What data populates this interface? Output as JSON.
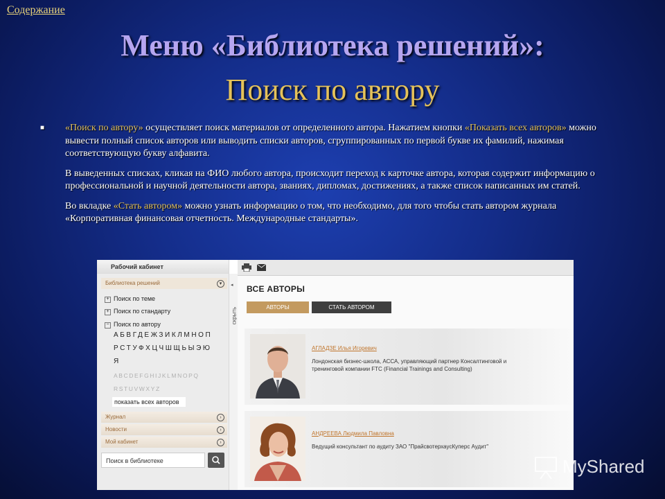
{
  "nav": {
    "toc_link": "Содержание"
  },
  "slide": {
    "title_line1": "Меню «Библиотека решений»:",
    "title_line2": "Поиск по автору",
    "p1_hl1": "«Поиск по автору»",
    "p1_text1": " осуществляет поиск материалов от определенного автора. Нажатием кнопки ",
    "p1_hl2": "«Показать всех авторов»",
    "p1_text2": " можно вывести полный список авторов или выводить списки авторов, сгруппированных по первой букве их фамилий, нажимая соответствующую букву алфавита.",
    "p2": "В выведенных списках, кликая на ФИО любого автора, происходит переход к карточке автора, которая содержит информацию о профессиональной и научной деятельности автора, званиях, дипломах, достижениях, а также список написанных им статей.",
    "p3_text1": "Во вкладке ",
    "p3_hl": "«Стать автором»",
    "p3_text2": " можно узнать информацию о том, что необходимо, для того чтобы стать автором журнала «Корпоративная финансовая отчетность. Международные стандарты»."
  },
  "sidebar": {
    "header": "Рабочий кабинет",
    "section": "Библиотека решений",
    "tree": [
      "Поиск по теме",
      "Поиск по стандарту",
      "Поиск по автору"
    ],
    "alphabet_rows": [
      "АБВГДЕЖЗИКЛМНОП",
      "РСТУФХЦЧШЩЬЫЭЮ",
      "Я"
    ],
    "latin_rows": [
      "ABCDEFGHIJKLMNOPQ",
      "RSTUVWXYZ"
    ],
    "show_all": "показать всех авторов",
    "menu": [
      "Журнал",
      "Новости",
      "Мой кабинет"
    ],
    "search_label": "Поиск в библиотеке",
    "hide_label": "скрыть"
  },
  "main": {
    "heading": "ВСЕ АВТОРЫ",
    "tabs": [
      "АВТОРЫ",
      "СТАТЬ АВТОРОМ"
    ],
    "authors": [
      {
        "name": "АГЛАДЗЕ Илья Игоревич",
        "desc": "Лондонская бизнес-школа, АССА, управляющий партнер Консалтинговой и тренинговой компании FTC (Financial Trainings and Consulting)"
      },
      {
        "name": "АНДРЕЕВА Людмила Павловна",
        "desc": "Ведущий консультант по аудиту ЗАО \"ПрайсвотерхаусКуперс Аудит\""
      }
    ]
  },
  "watermark": {
    "text": "MyShared"
  },
  "icons": [
    "print-icon",
    "mail-icon",
    "search-icon",
    "chevron-icon",
    "plus-icon",
    "minus-icon"
  ]
}
